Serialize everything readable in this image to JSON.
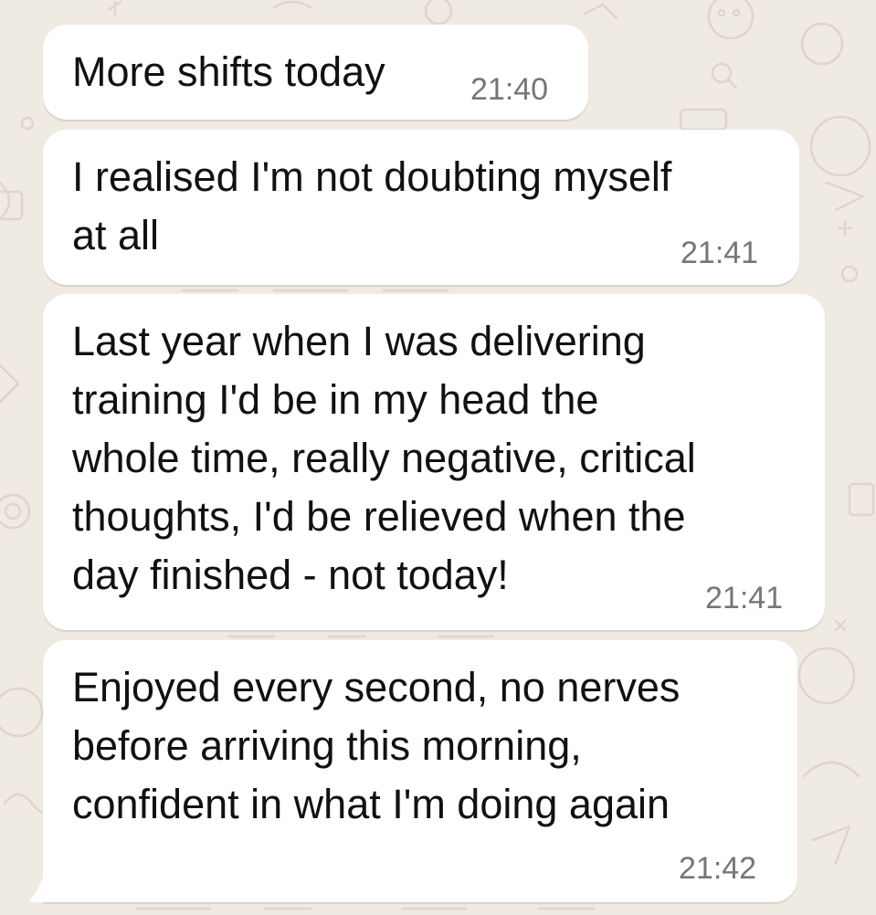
{
  "chat": {
    "messages": [
      {
        "lines": [
          "More shifts today"
        ],
        "time": "21:40"
      },
      {
        "lines": [
          "I realised I'm not doubting myself",
          "at all"
        ],
        "time": "21:41"
      },
      {
        "lines": [
          "Last year when I was delivering",
          "training I'd be in my head the",
          "whole time, really negative, critical",
          "thoughts, I'd be relieved when the",
          "day finished - not today!"
        ],
        "time": "21:41"
      },
      {
        "lines": [
          "Enjoyed every second, no nerves",
          "before arriving this morning,",
          "confident in what I'm doing again"
        ],
        "time": "21:42"
      }
    ]
  },
  "theme": {
    "wallpaper_color": "#efeae2",
    "bubble_color": "#ffffff",
    "text_color": "#111111",
    "time_color": "#767676"
  }
}
